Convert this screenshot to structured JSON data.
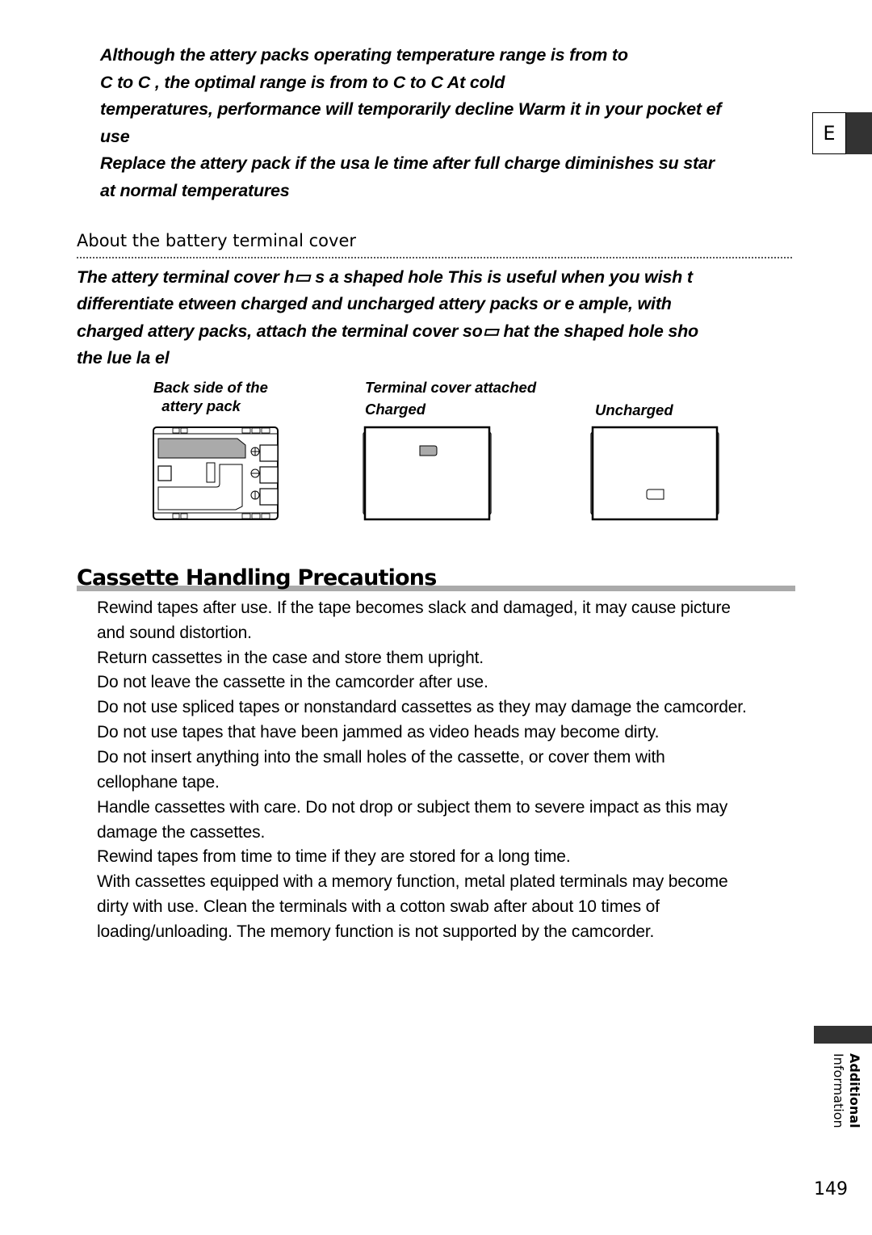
{
  "battery_notes": {
    "temp_paragraph": [
      "Although the   attery packs operating temperature range is from         to",
      "    C to     C , the optimal range is from         to               C to     C   At cold",
      "temperatures, performance will temporarily decline  Warm it in your pocket   ef",
      "use"
    ],
    "replace_paragraph": [
      "Replace the   attery pack if the usa  le time after full charge diminishes su  star",
      "at normal temperatures"
    ]
  },
  "terminal_cover": {
    "heading": "About the battery terminal cover",
    "paragraph": [
      "The   attery terminal cover h▭ s a        shaped hole  This is useful when you wish t",
      "differentiate   etween charged and uncharged   attery packs    or e  ample, with",
      "charged   attery packs, attach the terminal cover so▭ hat the        shaped hole sho",
      "the   lue la  el"
    ],
    "figure": {
      "back_side_label": [
        "Back side of the",
        "  attery pack"
      ],
      "attached_label": "Terminal cover attached",
      "charged_label": "Charged",
      "uncharged_label": "Uncharged"
    }
  },
  "cassette": {
    "heading": "Cassette Handling Precautions",
    "lines": [
      "Rewind tapes after use. If the tape becomes slack and damaged, it may cause picture",
      "and sound distortion.",
      "Return cassettes in the case and store them upright.",
      "Do not leave the cassette in the camcorder after use.",
      "Do not use spliced tapes or nonstandard cassettes as they may damage the camcorder.",
      "Do not use tapes that have been jammed as video heads may become dirty.",
      "Do not insert anything into the small holes of the cassette, or cover them with",
      "cellophane tape.",
      "Handle cassettes with care. Do not drop or subject them to severe impact as this may",
      "damage the cassettes.",
      "Rewind tapes from time to time if they are stored for a long time.",
      "With cassettes equipped with a memory function, metal plated terminals may become",
      "dirty with use. Clean the terminals with a cotton swab after about 10 times of",
      "loading/unloading. The memory function is not supported by the camcorder."
    ]
  },
  "side_tab": {
    "language": "E",
    "section_line1": "Additional",
    "section_line2": "Information"
  },
  "page_number": "149",
  "colors": {
    "tab_dark": "#333333",
    "heading_bar": "#aaaaaa",
    "label_fill": "#aaaaaa"
  }
}
